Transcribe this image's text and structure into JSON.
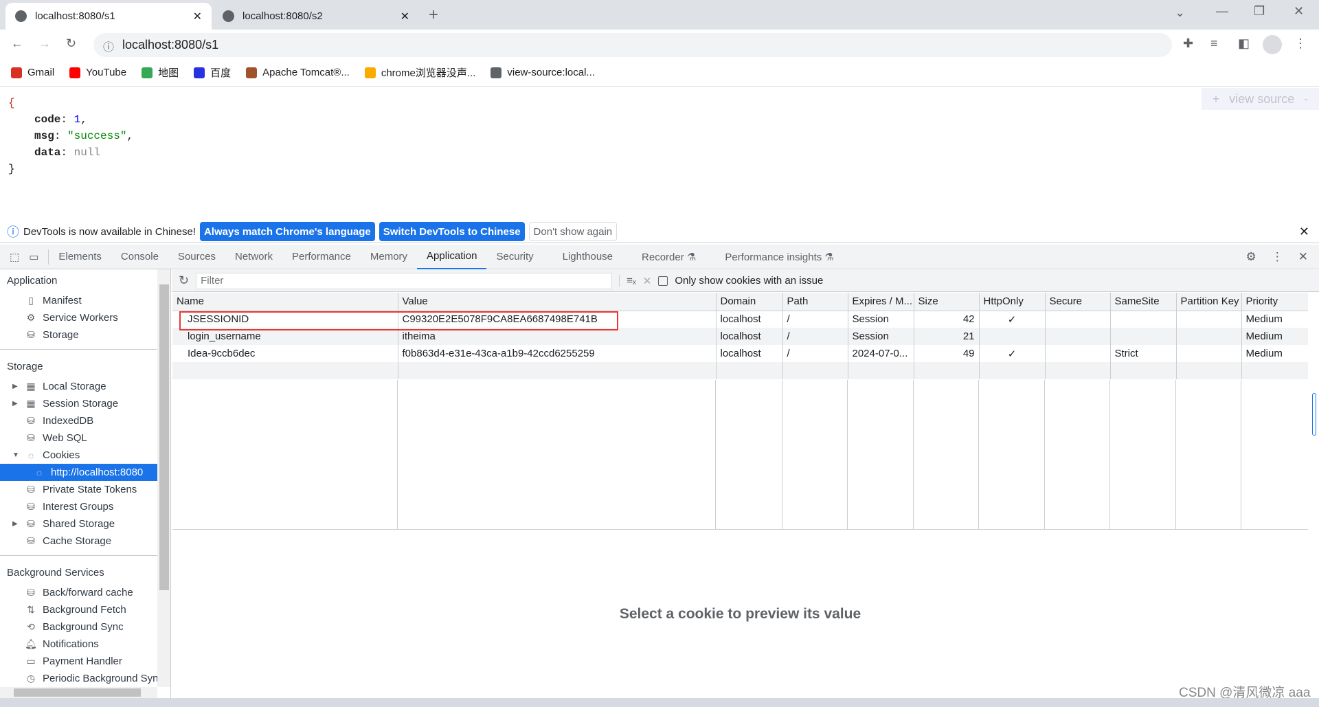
{
  "browser": {
    "tabs": [
      {
        "title": "localhost:8080/s1",
        "active": true
      },
      {
        "title": "localhost:8080/s2",
        "active": false
      }
    ],
    "url": "localhost:8080/s1",
    "bookmarks": [
      {
        "label": "Gmail",
        "icon": "gmail-icon"
      },
      {
        "label": "YouTube",
        "icon": "youtube-icon"
      },
      {
        "label": "地图",
        "icon": "maps-icon"
      },
      {
        "label": "百度",
        "icon": "baidu-icon"
      },
      {
        "label": "Apache Tomcat®...",
        "icon": "tomcat-icon"
      },
      {
        "label": "chrome浏览器没声...",
        "icon": "site-icon"
      },
      {
        "label": "view-source:local...",
        "icon": "globe-icon"
      }
    ]
  },
  "page": {
    "json": {
      "code": "1",
      "msg": "\"success\"",
      "data": "null"
    },
    "view_source": "view source"
  },
  "infobar": {
    "text": "DevTools is now available in Chinese!",
    "btn1": "Always match Chrome's language",
    "btn2": "Switch DevTools to Chinese",
    "btn3": "Don't show again"
  },
  "devtools": {
    "tabs": [
      "Elements",
      "Console",
      "Sources",
      "Network",
      "Performance",
      "Memory",
      "Application",
      "Security",
      "Lighthouse",
      "Recorder ⚗",
      "Performance insights ⚗"
    ],
    "active_tab": "Application"
  },
  "sidebar": {
    "sections": [
      {
        "title": "Application",
        "items": [
          {
            "label": "Manifest",
            "icon": "▯"
          },
          {
            "label": "Service Workers",
            "icon": "⚙"
          },
          {
            "label": "Storage",
            "icon": "⛁"
          }
        ]
      },
      {
        "title": "Storage",
        "items": [
          {
            "label": "Local Storage",
            "icon": "▦",
            "arrow": "▶"
          },
          {
            "label": "Session Storage",
            "icon": "▦",
            "arrow": "▶"
          },
          {
            "label": "IndexedDB",
            "icon": "⛁"
          },
          {
            "label": "Web SQL",
            "icon": "⛁"
          },
          {
            "label": "Cookies",
            "icon": "◌",
            "arrow": "▼"
          },
          {
            "label": "http://localhost:8080",
            "icon": "◌",
            "selected": true,
            "indent": 2
          },
          {
            "label": "Private State Tokens",
            "icon": "⛁"
          },
          {
            "label": "Interest Groups",
            "icon": "⛁"
          },
          {
            "label": "Shared Storage",
            "icon": "⛁",
            "arrow": "▶"
          },
          {
            "label": "Cache Storage",
            "icon": "⛁"
          }
        ]
      },
      {
        "title": "Background Services",
        "items": [
          {
            "label": "Back/forward cache",
            "icon": "⛁"
          },
          {
            "label": "Background Fetch",
            "icon": "⇅"
          },
          {
            "label": "Background Sync",
            "icon": "⟲"
          },
          {
            "label": "Notifications",
            "icon": "🔔︎"
          },
          {
            "label": "Payment Handler",
            "icon": "▭"
          },
          {
            "label": "Periodic Background Sync",
            "icon": "◷"
          }
        ]
      }
    ]
  },
  "toolbar": {
    "filter_placeholder": "Filter",
    "only_issues": "Only show cookies with an issue"
  },
  "cookies": {
    "columns": [
      "Name",
      "Value",
      "Domain",
      "Path",
      "Expires / M...",
      "Size",
      "HttpOnly",
      "Secure",
      "SameSite",
      "Partition Key",
      "Priority"
    ],
    "rows": [
      [
        "JSESSIONID",
        "C99320E2E5078F9CA8EA6687498E741B",
        "localhost",
        "/",
        "Session",
        "42",
        "✓",
        "",
        "",
        "",
        "Medium"
      ],
      [
        "login_username",
        "itheima",
        "localhost",
        "/",
        "Session",
        "21",
        "",
        "",
        "",
        "",
        "Medium"
      ],
      [
        "Idea-9ccb6dec",
        "f0b863d4-e31e-43ca-a1b9-42ccd6255259",
        "localhost",
        "/",
        "2024-07-0...",
        "49",
        "✓",
        "",
        "Strict",
        "",
        "Medium"
      ]
    ],
    "highlighted_row": "JSESSIONID"
  },
  "preview": "Select a cookie to preview its value",
  "watermark": "CSDN @清风微凉 aaa",
  "colors": {
    "accent": "#1a73e8",
    "highlight": "#e53935"
  }
}
